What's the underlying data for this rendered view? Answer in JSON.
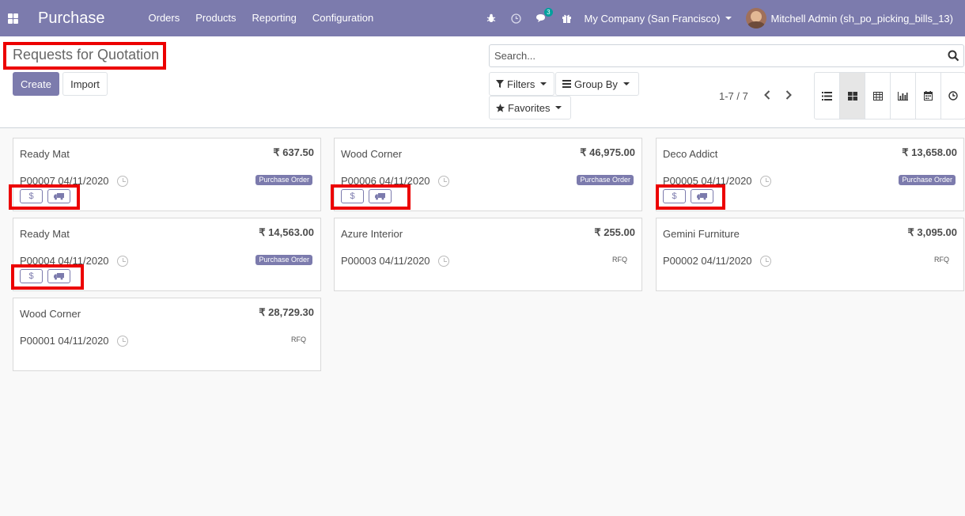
{
  "navbar": {
    "app_title": "Purchase",
    "menu": [
      "Orders",
      "Products",
      "Reporting",
      "Configuration"
    ],
    "messages_count": "3",
    "company": "My Company (San Francisco)",
    "user": "Mitchell Admin (sh_po_picking_bills_13)",
    "background_color": "#7c7bad"
  },
  "control": {
    "title": "Requests for Quotation",
    "create_label": "Create",
    "import_label": "Import",
    "search_placeholder": "Search...",
    "filters_label": "Filters",
    "group_by_label": "Group By",
    "favorites_label": "Favorites",
    "pager": "1-7 / 7",
    "views": [
      "list-view-icon",
      "kanban-view-icon",
      "pivot-view-icon",
      "graph-view-icon",
      "calendar-view-icon",
      "activity-view-icon"
    ],
    "active_view": "kanban-view-icon"
  },
  "cards": [
    {
      "partner": "Ready Mat",
      "amount": "₹ 637.50",
      "ref": "P00007 04/11/2020",
      "state": "Purchase Order"
    },
    {
      "partner": "Wood Corner",
      "amount": "₹ 46,975.00",
      "ref": "P00006 04/11/2020",
      "state": "Purchase Order"
    },
    {
      "partner": "Deco Addict",
      "amount": "₹ 13,658.00",
      "ref": "P00005 04/11/2020",
      "state": "Purchase Order"
    },
    {
      "partner": "Ready Mat",
      "amount": "₹ 14,563.00",
      "ref": "P00004 04/11/2020",
      "state": "Purchase Order"
    },
    {
      "partner": "Azure Interior",
      "amount": "₹ 255.00",
      "ref": "P00003 04/11/2020",
      "state": "RFQ"
    },
    {
      "partner": "Gemini Furniture",
      "amount": "₹ 3,095.00",
      "ref": "P00002 04/11/2020",
      "state": "RFQ"
    },
    {
      "partner": "Wood Corner",
      "amount": "₹ 28,729.30",
      "ref": "P00001 04/11/2020",
      "state": "RFQ"
    }
  ],
  "smart_buttons": {
    "bill": "$"
  },
  "highlight_color": "#ec0000"
}
